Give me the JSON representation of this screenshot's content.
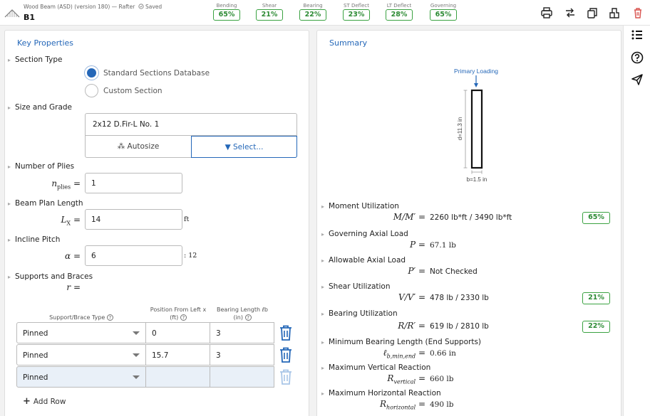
{
  "header": {
    "app_title": "Wood Beam (ASD) (version 180) — Rafter",
    "saved_label": "Saved",
    "beam_name": "B1",
    "badges": [
      {
        "label": "Bending",
        "value": "65%"
      },
      {
        "label": "Shear",
        "value": "21%"
      },
      {
        "label": "Bearing",
        "value": "22%"
      },
      {
        "label": "ST Deflect",
        "value": "23%"
      },
      {
        "label": "LT Deflect",
        "value": "28%"
      },
      {
        "label": "Governing",
        "value": "65%"
      }
    ],
    "status_color": "#3aa241",
    "delete_color": "#d9534f"
  },
  "left": {
    "title": "Key Properties",
    "section_type": {
      "label": "Section Type",
      "options": [
        "Standard Sections Database",
        "Custom Section"
      ],
      "selected": "Standard Sections Database"
    },
    "size_grade": {
      "label": "Size and Grade",
      "value": "2x12 D.Fir-L No. 1",
      "autosize_label": "Autosize",
      "select_label": "Select..."
    },
    "plies": {
      "label": "Number of Plies",
      "var": "n",
      "var_sub": "plies",
      "value": "1"
    },
    "length": {
      "label": "Beam Plan Length",
      "var": "L",
      "var_sub": "X",
      "value": "14",
      "unit": "ft"
    },
    "pitch": {
      "label": "Incline Pitch",
      "var": "α",
      "value": "6",
      "unit": ": 12"
    },
    "supports": {
      "label": "Supports and Braces",
      "var": "r",
      "headers": {
        "type": "Support/Brace Type",
        "position": "Position From Left x",
        "position_unit": "(ft)",
        "bearing": "Bearing Length ℓb",
        "bearing_unit": "(in)"
      },
      "rows": [
        {
          "type": "Pinned",
          "position": "0",
          "bearing": "3"
        },
        {
          "type": "Pinned",
          "position": "15.7",
          "bearing": "3"
        },
        {
          "type": "Pinned",
          "position": "",
          "bearing": ""
        }
      ],
      "add_row_label": "Add Row"
    }
  },
  "right": {
    "title": "Summary",
    "diagram": {
      "loading_label": "Primary Loading",
      "depth_label": "d=11.3 in",
      "width_label": "b=1.5 in"
    },
    "results": [
      {
        "label": "Moment Utilization",
        "eq": "M/M′ =",
        "value": "2260 lb*ft / 3490 lb*ft",
        "badge": "65%"
      },
      {
        "label": "Governing Axial Load",
        "eq": "P =",
        "value": "67.1 lb",
        "badge": ""
      },
      {
        "label": "Allowable Axial Load",
        "eq": "P′ =",
        "value": "Not Checked",
        "badge": ""
      },
      {
        "label": "Shear Utilization",
        "eq": "V/V′ =",
        "value": "478 lb / 2330 lb",
        "badge": "21%"
      },
      {
        "label": "Bearing Utilization",
        "eq": "R/R′ =",
        "value": "619 lb / 2810 lb",
        "badge": "22%"
      },
      {
        "label": "Minimum Bearing Length (End Supports)",
        "eq": "ℓ",
        "eq_sub": "b,min,end",
        "value": "0.66 in",
        "badge": ""
      },
      {
        "label": "Maximum Vertical Reaction",
        "eq": "R",
        "eq_sub": "vertical",
        "value": "660 lb",
        "badge": ""
      },
      {
        "label": "Maximum Horizontal Reaction",
        "eq": "R",
        "eq_sub": "horizontal",
        "value": "490 lb",
        "badge": ""
      }
    ]
  },
  "rail": {
    "icons": [
      "list-icon",
      "help-icon",
      "send-icon"
    ]
  }
}
